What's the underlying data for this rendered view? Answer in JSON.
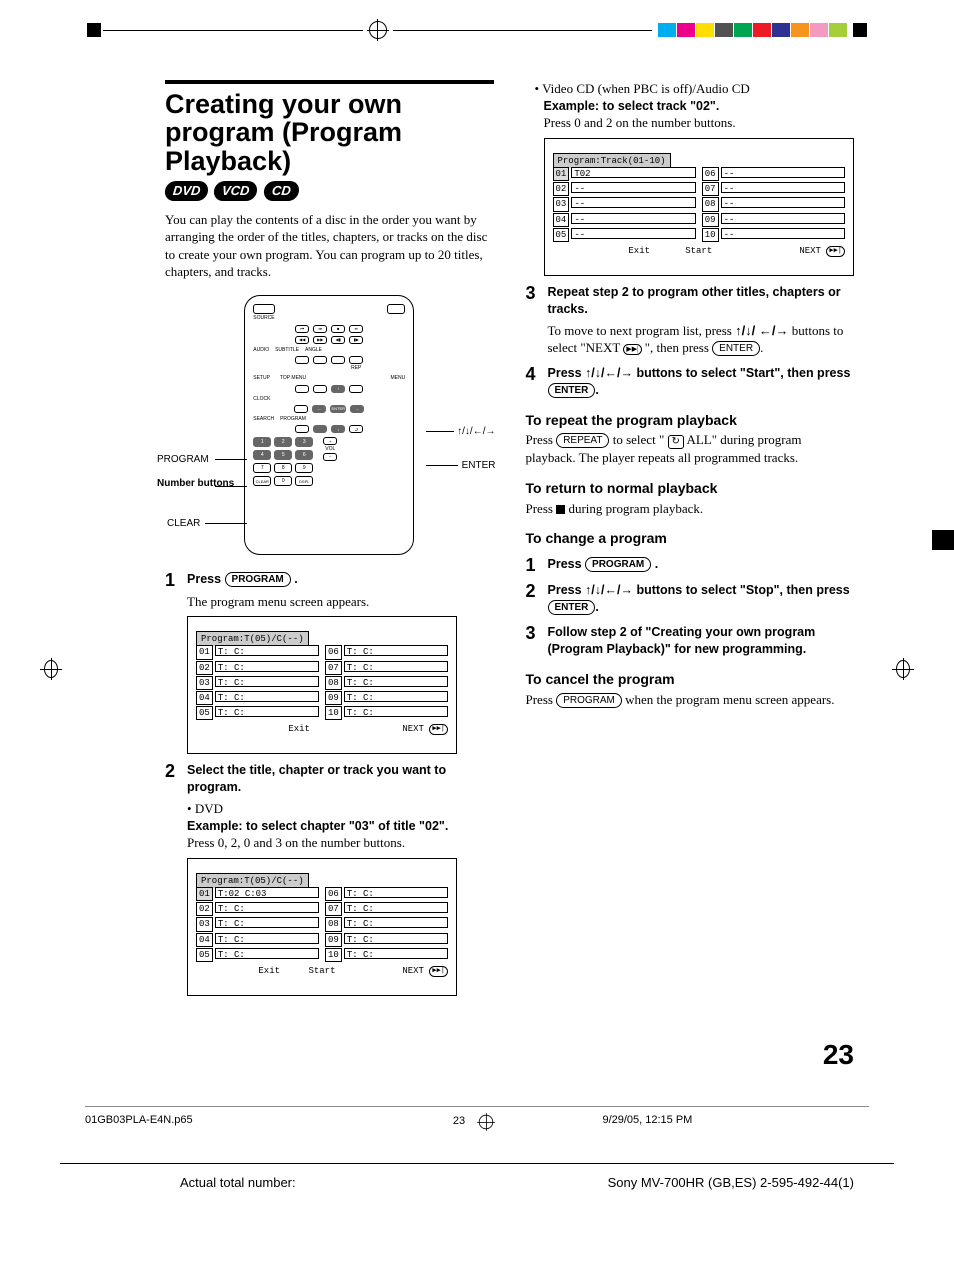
{
  "registration": {
    "swatches": [
      "#00aeef",
      "#ec008c",
      "#ffde00",
      "#525252",
      "#00a551",
      "#ed1c24",
      "#2e3192",
      "#f7941d",
      "#f49ac1",
      "#a6ce39"
    ]
  },
  "leftColumn": {
    "heading": "Creating your own program (Program Playback)",
    "badges": [
      "DVD",
      "VCD",
      "CD"
    ],
    "intro": "You can play the contents of a disc in the order you want by arranging the order of the titles, chapters, or tracks on the disc to create your own program. You can program up to 20 titles, chapters, and tracks.",
    "remote": {
      "topRow": {
        "source": "SOURCE",
        "power": "⏻"
      },
      "transport": [
        "⏮",
        "⏭",
        "■",
        "⏯"
      ],
      "transport2": [
        "◀◀",
        "▶▶",
        "◀▮",
        "▮▶"
      ],
      "labelsRow": [
        "AUDIO",
        "SUBTITLE",
        "ANGLE"
      ],
      "row4": [
        "SETUP",
        "TOP MENU",
        "REP",
        "MENU"
      ],
      "clock": "CLOCK",
      "navUp": "↑",
      "navDown": "↓",
      "navLeft": "←",
      "navRight": "→",
      "enter": "ENTER",
      "search": "SEARCH",
      "program": "PROGRAM",
      "return": "⮐",
      "keypad": [
        "1",
        "2",
        "3",
        "4",
        "5",
        "6",
        "7",
        "8",
        "9",
        "CLEAR",
        "0",
        "DSPL"
      ],
      "vol": "VOL",
      "callouts": {
        "arrows": "↑/↓/←/→",
        "program": "PROGRAM",
        "numbers": "Number buttons",
        "clear": "CLEAR",
        "enter": "ENTER"
      }
    },
    "step1": {
      "title_a": "Press ",
      "title_btn": "PROGRAM",
      "title_b": ".",
      "body": "The program menu screen appears."
    },
    "osd1": {
      "header": "Program:T(05)/C(--)",
      "rows": [
        {
          "n": "01",
          "v": "T:   C:"
        },
        {
          "n": "06",
          "v": "T:   C:"
        },
        {
          "n": "02",
          "v": "T:   C:"
        },
        {
          "n": "07",
          "v": "T:   C:"
        },
        {
          "n": "03",
          "v": "T:   C:"
        },
        {
          "n": "08",
          "v": "T:   C:"
        },
        {
          "n": "04",
          "v": "T:   C:"
        },
        {
          "n": "09",
          "v": "T:   C:"
        },
        {
          "n": "05",
          "v": "T:   C:"
        },
        {
          "n": "10",
          "v": "T:   C:"
        }
      ],
      "exit": "Exit",
      "next": "NEXT"
    },
    "step2": {
      "title": "Select the title, chapter or track you want to program.",
      "dvd_label": "DVD",
      "dvd_example": "Example: to select chapter \"03\" of title \"02\".",
      "dvd_body": "Press 0, 2, 0 and 3 on the number buttons."
    },
    "osd2": {
      "header": "Program:T(05)/C(--)",
      "rows": [
        {
          "n": "01",
          "v": "T:02 C:03",
          "sel": true
        },
        {
          "n": "06",
          "v": "T:   C:"
        },
        {
          "n": "02",
          "v": "T:   C:"
        },
        {
          "n": "07",
          "v": "T:   C:"
        },
        {
          "n": "03",
          "v": "T:   C:"
        },
        {
          "n": "08",
          "v": "T:   C:"
        },
        {
          "n": "04",
          "v": "T:   C:"
        },
        {
          "n": "09",
          "v": "T:   C:"
        },
        {
          "n": "05",
          "v": "T:   C:"
        },
        {
          "n": "10",
          "v": "T:   C:"
        }
      ],
      "exit": "Exit",
      "start": "Start",
      "next": "NEXT"
    }
  },
  "rightColumn": {
    "vcd_line": "Video CD (when PBC is off)/Audio CD",
    "vcd_example": "Example: to select track \"02\".",
    "vcd_body": "Press 0 and 2 on the number buttons.",
    "osd3": {
      "header": "Program:Track(01-10)",
      "rows": [
        {
          "n": "01",
          "v": "T02",
          "sel": true
        },
        {
          "n": "06",
          "v": "--"
        },
        {
          "n": "02",
          "v": "--"
        },
        {
          "n": "07",
          "v": "--"
        },
        {
          "n": "03",
          "v": "--"
        },
        {
          "n": "08",
          "v": "--"
        },
        {
          "n": "04",
          "v": "--"
        },
        {
          "n": "09",
          "v": "--"
        },
        {
          "n": "05",
          "v": "--"
        },
        {
          "n": "10",
          "v": "--"
        }
      ],
      "exit": "Exit",
      "start": "Start",
      "next": "NEXT"
    },
    "step3": {
      "title": "Repeat step 2 to program other titles, chapters or tracks.",
      "body_a": "To move to next program list, press ",
      "body_b": " buttons to select \"NEXT ",
      "body_c": "\", then press ",
      "enter": "ENTER",
      "arrows": "↑/↓/ ←/→"
    },
    "step4": {
      "title_a": "Press ",
      "arrows": "↑/↓/←/→",
      "title_b": " buttons to select \"Start\", then press ",
      "enter": "ENTER",
      "title_c": "."
    },
    "repeat": {
      "heading": "To repeat the program playback",
      "body_a": "Press ",
      "repeat_btn": "REPEAT",
      "body_b": " to select \"",
      "loop": "↻",
      "body_c": " ALL\" during program playback. The player repeats all programmed tracks."
    },
    "normal": {
      "heading": "To return to normal playback",
      "body_a": "Press ",
      "body_b": " during program playback."
    },
    "change": {
      "heading": "To change a program",
      "s1_a": "Press ",
      "s1_btn": "PROGRAM",
      "s1_b": ".",
      "s2_a": "Press ",
      "s2_arrows": "↑/↓/←/→",
      "s2_b": " buttons to select \"Stop\", then press ",
      "s2_btn": "ENTER",
      "s2_c": ".",
      "s3": "Follow step 2 of \"Creating your own program (Program Playback)\" for new programming."
    },
    "cancel": {
      "heading": "To cancel the program",
      "body_a": "Press ",
      "btn": "PROGRAM",
      "body_b": " when the program menu screen appears."
    }
  },
  "pageNumber": "23",
  "footer1": {
    "file": "01GB03PLA-E4N.p65",
    "page": "23",
    "date": "9/29/05, 12:15 PM"
  },
  "footer2": {
    "left": "Actual total number:",
    "right": "Sony MV-700HR (GB,ES) 2-595-492-44(1)"
  }
}
